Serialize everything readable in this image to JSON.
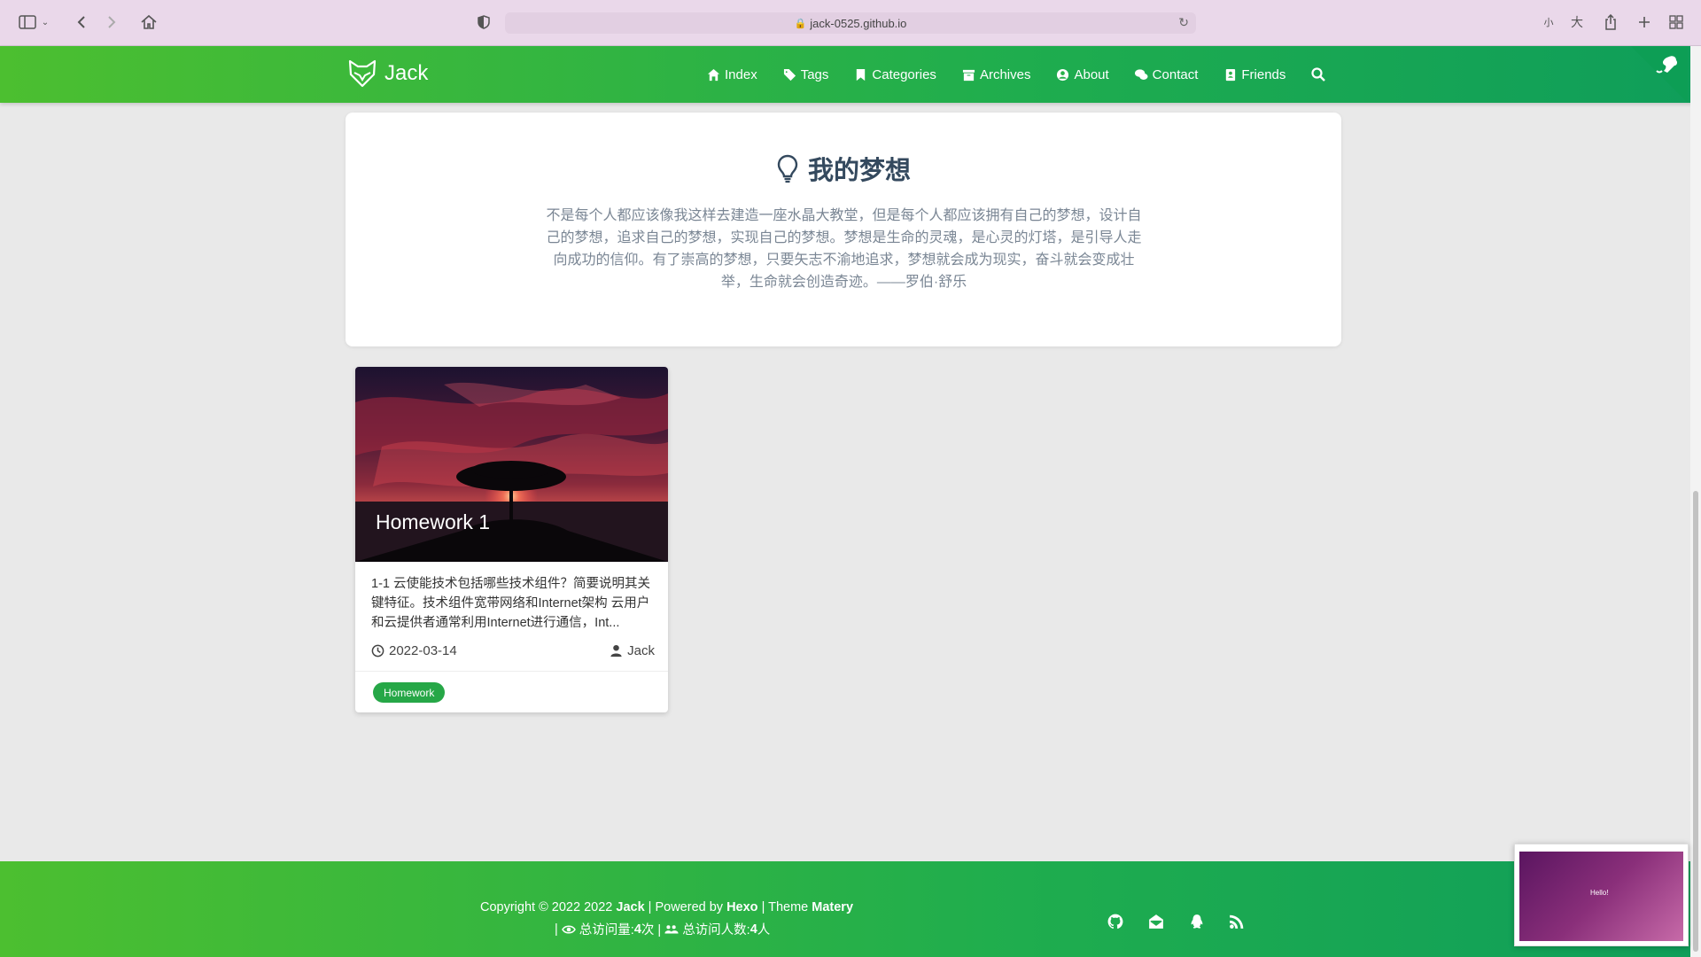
{
  "browser": {
    "url": "jack-0525.github.io",
    "zoom_small": "小",
    "zoom_large": "大"
  },
  "header": {
    "site_name": "Jack",
    "nav": [
      {
        "label": "Index",
        "icon": "home-icon"
      },
      {
        "label": "Tags",
        "icon": "tags-icon"
      },
      {
        "label": "Categories",
        "icon": "bookmark-icon"
      },
      {
        "label": "Archives",
        "icon": "archive-icon"
      },
      {
        "label": "About",
        "icon": "user-circle-icon"
      },
      {
        "label": "Contact",
        "icon": "comments-icon"
      },
      {
        "label": "Friends",
        "icon": "address-book-icon"
      }
    ]
  },
  "dream": {
    "title": "我的梦想",
    "text": "不是每个人都应该像我这样去建造一座水晶大教堂，但是每个人都应该拥有自己的梦想，设计自己的梦想，追求自己的梦想，实现自己的梦想。梦想是生命的灵魂，是心灵的灯塔，是引导人走向成功的信仰。有了崇高的梦想，只要矢志不渝地追求，梦想就会成为现实，奋斗就会变成壮举，生命就会创造奇迹。——罗伯·舒乐"
  },
  "article": {
    "title": "Homework 1",
    "summary": "1-1 云使能技术包括哪些技术组件？简要说明其关键特征。技术组件宽带网络和Internet架构 云用户和云提供者通常利用Internet进行通信，Int...",
    "date": "2022-03-14",
    "author": "Jack",
    "tag": "Homework"
  },
  "footer": {
    "copyright_prefix": "Copyright © 2022 2022 ",
    "author": "Jack",
    "powered_prefix": " | Powered by ",
    "powered": "Hexo",
    "theme_prefix": " | Theme ",
    "theme": "Matery",
    "visits_label": "总访问量: ",
    "visits": "4",
    "visits_unit": " 次 | ",
    "visitors_label": "总访问人数: ",
    "visitors": "4",
    "visitors_unit": " 人",
    "line2_prefix": "| "
  },
  "preview": {
    "text": "Hello!"
  },
  "colors": {
    "header_start": "#4cbf30",
    "header_end": "#0f9e5a",
    "tag": "#26a747",
    "title": "#34495e"
  }
}
